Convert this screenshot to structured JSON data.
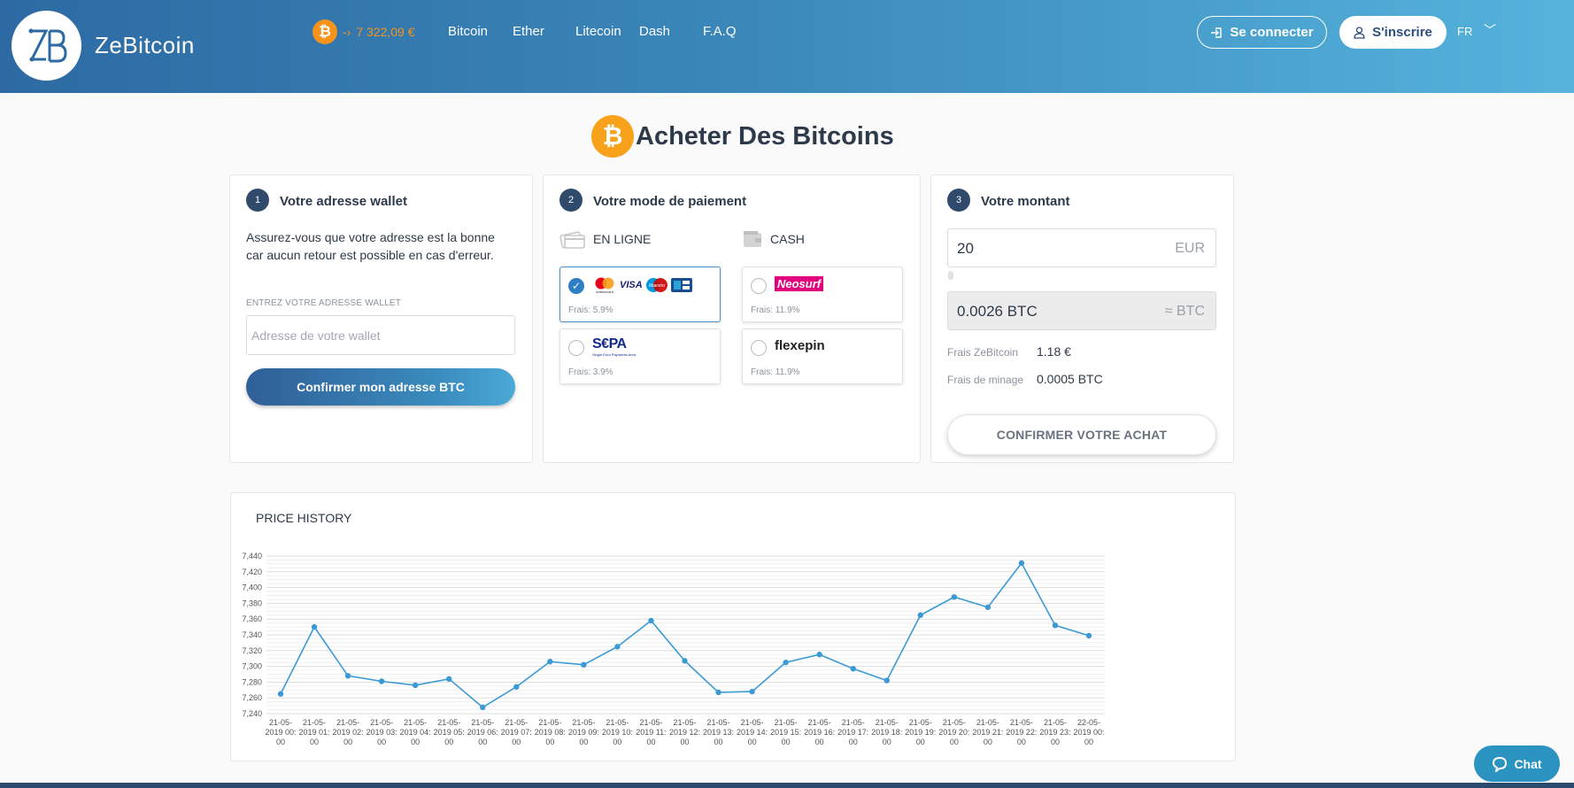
{
  "header": {
    "brand": "ZeBitcoin",
    "price": "7 322,09 €",
    "nav": [
      "Bitcoin",
      "Ether",
      "Litecoin",
      "Dash",
      "F.A.Q"
    ],
    "login_label": "Se connecter",
    "signup_label": "S'inscrire",
    "lang": "FR"
  },
  "page": {
    "title": "Acheter Des Bitcoins"
  },
  "step1": {
    "num": "1",
    "title": "Votre adresse wallet",
    "text": "Assurez-vous que votre adresse est la bonne car aucun retour est possible en cas d'erreur.",
    "label": "ENTREZ VOTRE ADRESSE WALLET",
    "placeholder": "Adresse de votre wallet",
    "button": "Confirmer mon adresse BTC"
  },
  "step2": {
    "num": "2",
    "title": "Votre mode de paiement",
    "online_label": "EN LIGNE",
    "cash_label": "CASH",
    "methods": [
      {
        "name": "card",
        "fee": "Frais: 5.9%",
        "selected": true
      },
      {
        "name": "Neosurf",
        "fee": "Frais: 11.9%",
        "selected": false
      },
      {
        "name": "SEPA",
        "fee": "Frais: 3.9%",
        "selected": false
      },
      {
        "name": "flexepin",
        "fee": "Frais: 11.9%",
        "selected": false
      }
    ],
    "logos": {
      "visa": "VISA",
      "maestro": "Maestro",
      "mastercard": "mastercard",
      "sepa_main": "S€PA",
      "sepa_sub": "Single Euro Payments Area",
      "neosurf": "Neosurf",
      "flexepin": "flexepin"
    }
  },
  "step3": {
    "num": "3",
    "title": "Votre montant",
    "amount": "20",
    "currency": "EUR",
    "btc_amount": "0.0026 BTC",
    "btc_cur": "≈ BTC",
    "fee_label": "Frais ZeBitcoin",
    "fee_value": "1.18 €",
    "mining_label": "Frais de minage",
    "mining_value": "0.0005 BTC",
    "confirm": "CONFIRMER VOTRE ACHAT"
  },
  "chat": {
    "label": "Chat"
  },
  "colors": {
    "accent": "#2f7fc4",
    "bitcoin": "#f7931a",
    "line": "#3b9ad6"
  },
  "chart_data": {
    "type": "line",
    "title": "PRICE HISTORY",
    "categories": [
      "21-05-2019 00:00",
      "21-05-2019 01:00",
      "21-05-2019 02:00",
      "21-05-2019 03:00",
      "21-05-2019 04:00",
      "21-05-2019 05:00",
      "21-05-2019 06:00",
      "21-05-2019 07:00",
      "21-05-2019 08:00",
      "21-05-2019 09:00",
      "21-05-2019 10:00",
      "21-05-2019 11:00",
      "21-05-2019 12:00",
      "21-05-2019 13:00",
      "21-05-2019 14:00",
      "21-05-2019 15:00",
      "21-05-2019 16:00",
      "21-05-2019 17:00",
      "21-05-2019 18:00",
      "21-05-2019 19:00",
      "21-05-2019 20:00",
      "21-05-2019 21:00",
      "21-05-2019 22:00",
      "21-05-2019 23:00",
      "22-05-2019 00:00"
    ],
    "tick_labels": [
      [
        "21-05-",
        "2019 00:",
        "00"
      ],
      [
        "21-05-",
        "2019 01:",
        "00"
      ],
      [
        "21-05-",
        "2019 02:",
        "00"
      ],
      [
        "21-05-",
        "2019 03:",
        "00"
      ],
      [
        "21-05-",
        "2019 04:",
        "00"
      ],
      [
        "21-05-",
        "2019 05:",
        "00"
      ],
      [
        "21-05-",
        "2019 06:",
        "00"
      ],
      [
        "21-05-",
        "2019 07:",
        "00"
      ],
      [
        "21-05-",
        "2019 08:",
        "00"
      ],
      [
        "21-05-",
        "2019 09:",
        "00"
      ],
      [
        "21-05-",
        "2019 10:",
        "00"
      ],
      [
        "21-05-",
        "2019 11:",
        "00"
      ],
      [
        "21-05-",
        "2019 12:",
        "00"
      ],
      [
        "21-05-",
        "2019 13:",
        "00"
      ],
      [
        "21-05-",
        "2019 14:",
        "00"
      ],
      [
        "21-05-",
        "2019 15:",
        "00"
      ],
      [
        "21-05-",
        "2019 16:",
        "00"
      ],
      [
        "21-05-",
        "2019 17:",
        "00"
      ],
      [
        "21-05-",
        "2019 18:",
        "00"
      ],
      [
        "21-05-",
        "2019 19:",
        "00"
      ],
      [
        "21-05-",
        "2019 20:",
        "00"
      ],
      [
        "21-05-",
        "2019 21:",
        "00"
      ],
      [
        "21-05-",
        "2019 22:",
        "00"
      ],
      [
        "21-05-",
        "2019 23:",
        "00"
      ],
      [
        "22-05-",
        "2019 00:",
        "00"
      ]
    ],
    "values": [
      7265,
      7350,
      7288,
      7281,
      7276,
      7284,
      7248,
      7274,
      7306,
      7302,
      7325,
      7358,
      7307,
      7267,
      7268,
      7305,
      7315,
      7297,
      7282,
      7365,
      7388,
      7375,
      7431,
      7352,
      7339
    ],
    "ylim": [
      7240,
      7440
    ],
    "yticks": [
      7240,
      7260,
      7280,
      7300,
      7320,
      7340,
      7360,
      7380,
      7400,
      7420,
      7440
    ],
    "ytick_labels": [
      "7,240",
      "7,260",
      "7,280",
      "7,300",
      "7,320",
      "7,340",
      "7,360",
      "7,380",
      "7,400",
      "7,420",
      "7,440"
    ],
    "grid": true
  }
}
